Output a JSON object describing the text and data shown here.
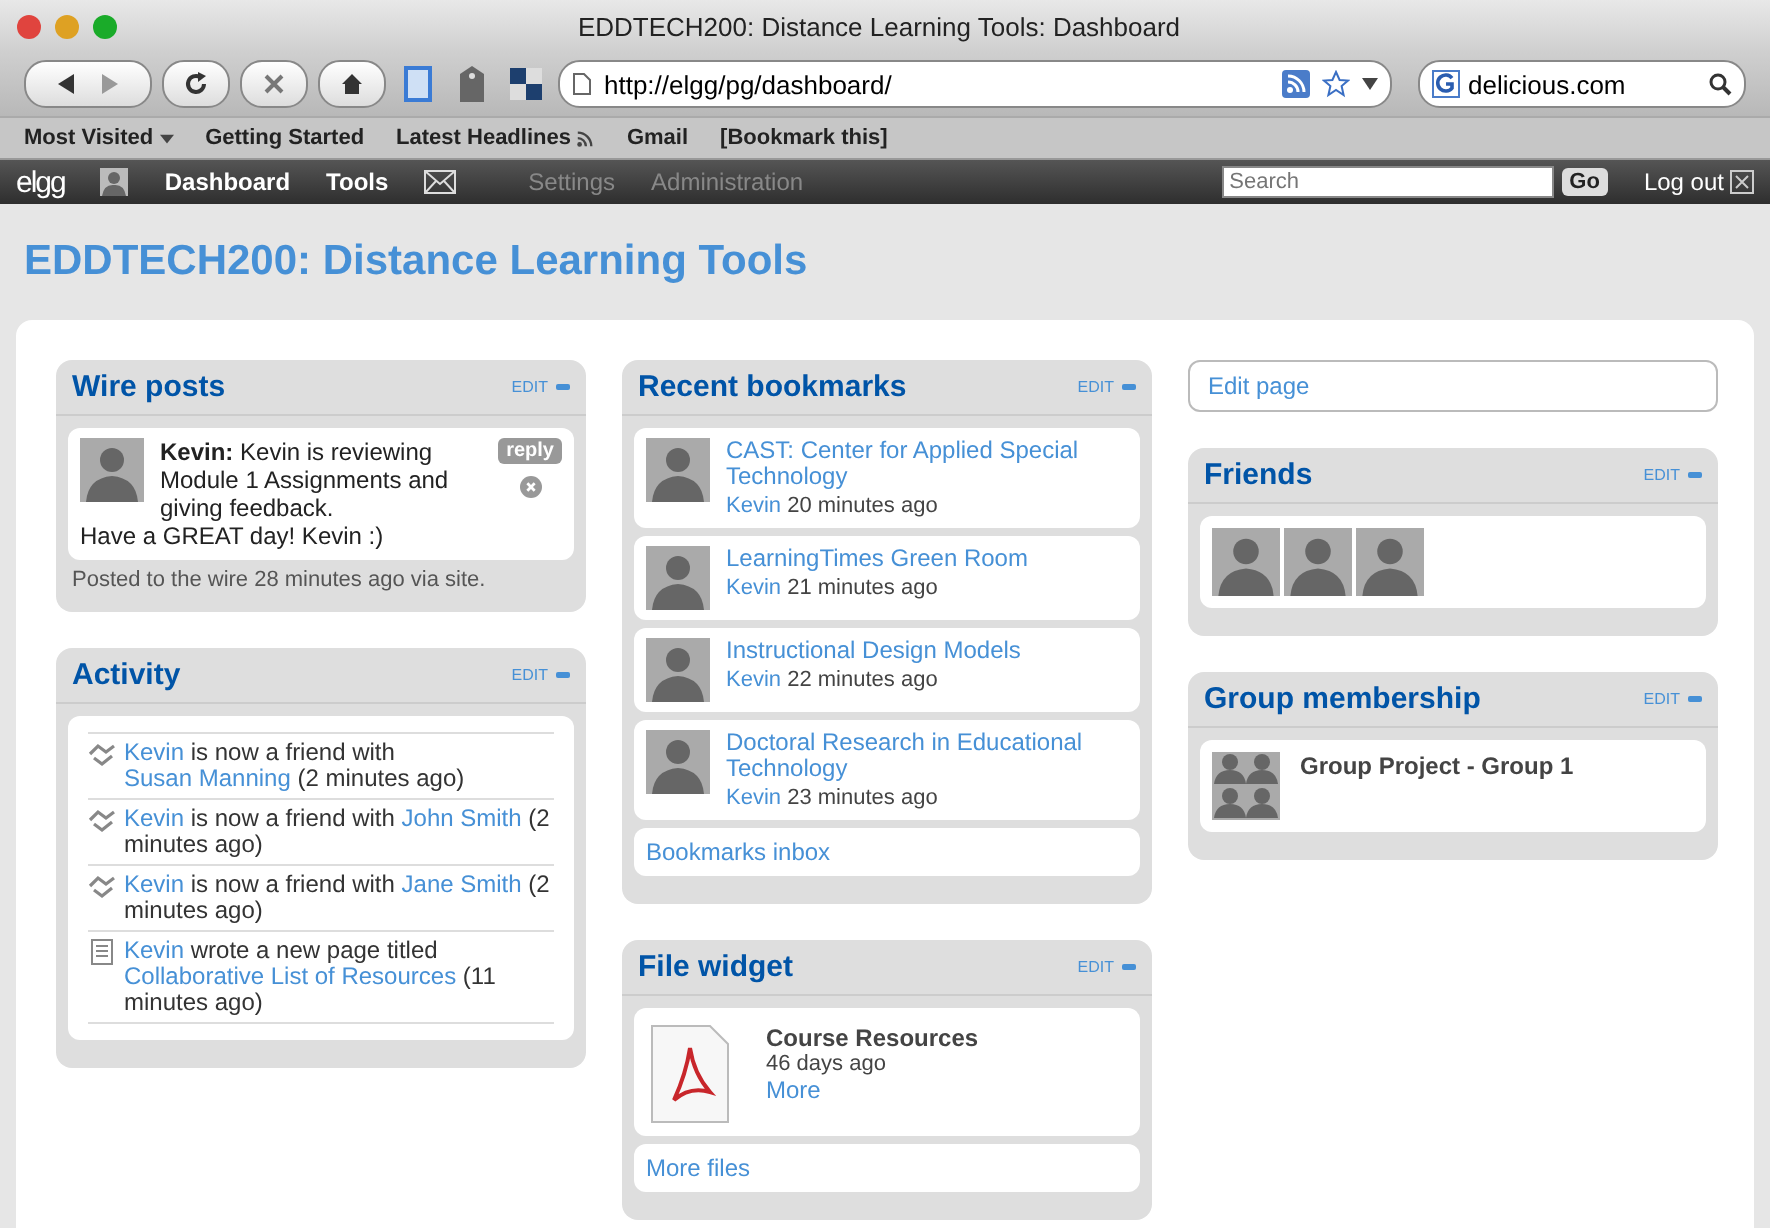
{
  "window": {
    "title": "EDDTECH200: Distance Learning Tools: Dashboard"
  },
  "toolbar": {
    "url": "http://elgg/pg/dashboard/",
    "search_value": "delicious.com"
  },
  "bookmarks_bar": [
    {
      "label": "Most Visited",
      "kind": "menu"
    },
    {
      "label": "Getting Started",
      "kind": "plain"
    },
    {
      "label": "Latest Headlines",
      "kind": "feed"
    },
    {
      "label": "Gmail",
      "kind": "plain"
    },
    {
      "label": "[Bookmark this]",
      "kind": "plain"
    }
  ],
  "site_bar": {
    "logo": "elgg",
    "items": [
      {
        "label": "Dashboard",
        "disabled": false
      },
      {
        "label": "Tools",
        "disabled": false
      },
      {
        "label": "Settings",
        "disabled": true
      },
      {
        "label": "Administration",
        "disabled": true
      }
    ],
    "search": {
      "placeholder": "Search"
    },
    "search_button": "Go",
    "logout": "Log out"
  },
  "page_title": "EDDTECH200: Distance Learning Tools",
  "columns": [
    {
      "widgets": [
        {
          "kind": "wire",
          "title": "Wire posts",
          "edit": "EDIT",
          "author": "Kevin:",
          "message": "Kevin is reviewing Module 1 Assignments and giving feedback.",
          "message_tail": "Have a GREAT day! Kevin :)",
          "reply": "reply",
          "footer": "Posted to the wire 28 minutes ago via site."
        },
        {
          "kind": "activity",
          "title": "Activity",
          "edit": "EDIT",
          "items": [
            {
              "kind": "friend",
              "actor": "Kevin",
              "verb": "is now a friend with",
              "object": "Susan Manning",
              "time": "(2 minutes ago)"
            },
            {
              "kind": "friend",
              "actor": "Kevin",
              "verb": "is now a friend with",
              "object": "John Smith",
              "time": "(2 minutes ago)"
            },
            {
              "kind": "friend",
              "actor": "Kevin",
              "verb": "is now a friend with",
              "object": "Jane Smith",
              "time": "(2 minutes ago)"
            },
            {
              "kind": "page",
              "actor": "Kevin",
              "verb": "wrote a new page titled",
              "object": "Collaborative List of Resources",
              "time": "(11 minutes ago)"
            }
          ]
        }
      ]
    },
    {
      "widgets": [
        {
          "kind": "bookmarks",
          "title": "Recent bookmarks",
          "edit": "EDIT",
          "items": [
            {
              "title": "CAST: Center for Applied Special Technology",
              "author": "Kevin",
              "time": "20 minutes ago"
            },
            {
              "title": "LearningTimes Green Room",
              "author": "Kevin",
              "time": "21 minutes ago"
            },
            {
              "title": "Instructional Design Models",
              "author": "Kevin",
              "time": "22 minutes ago"
            },
            {
              "title": "Doctoral Research in Educational Technology",
              "author": "Kevin",
              "time": "23 minutes ago"
            }
          ],
          "more": "Bookmarks inbox"
        },
        {
          "kind": "files",
          "title": "File widget",
          "edit": "EDIT",
          "items": [
            {
              "title": "Course Resources",
              "time": "46 days ago",
              "more": "More"
            }
          ],
          "more": "More files"
        }
      ]
    },
    {
      "edit_page": "Edit page",
      "widgets": [
        {
          "kind": "friends",
          "title": "Friends",
          "edit": "EDIT",
          "members": [
            {
              "kind": "avatar"
            },
            {
              "kind": "avatar"
            },
            {
              "kind": "avatar"
            }
          ]
        },
        {
          "kind": "groups",
          "title": "Group membership",
          "edit": "EDIT",
          "items": [
            {
              "name": "Group Project - Group 1"
            }
          ]
        }
      ]
    }
  ]
}
